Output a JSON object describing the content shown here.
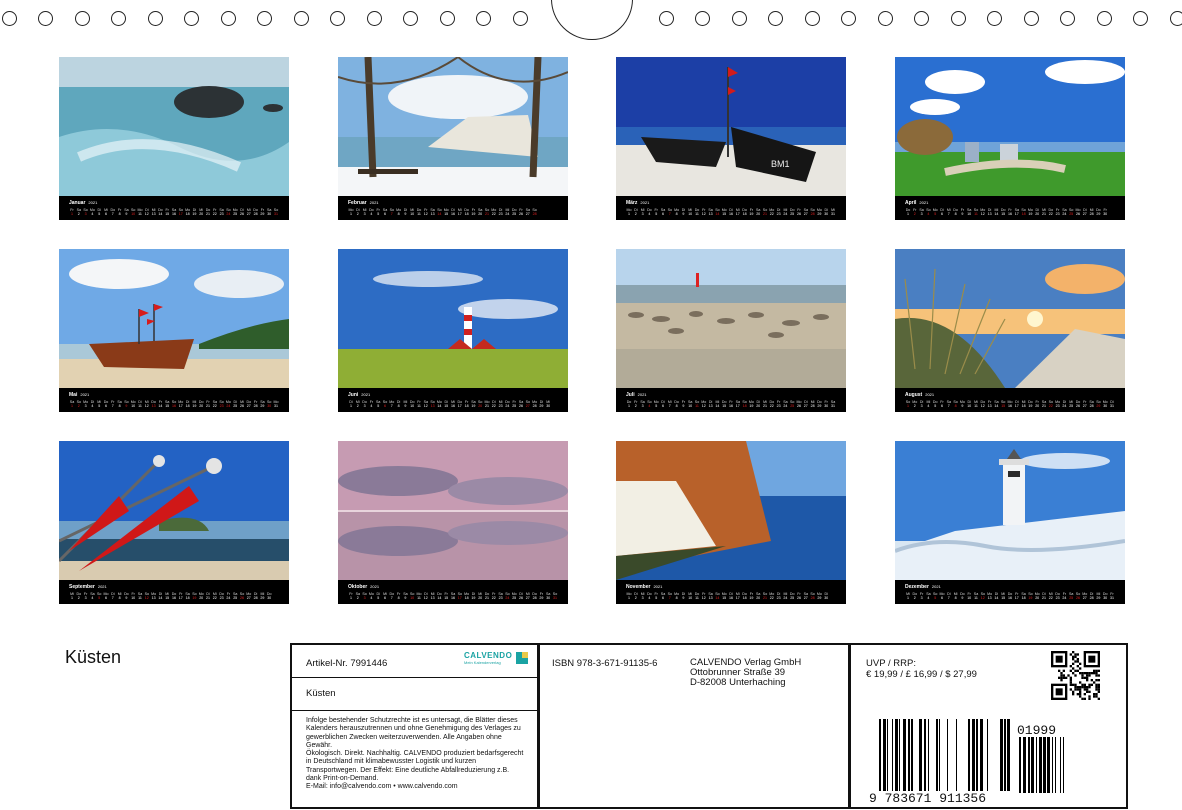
{
  "months": [
    {
      "name": "Januar",
      "year": "2021",
      "photo": "rock-in-sea",
      "first_weekday": 4,
      "length": 31,
      "holidays": [
        1
      ]
    },
    {
      "name": "Februar",
      "year": "2021",
      "photo": "chalk-cliffs-winter",
      "first_weekday": 0,
      "length": 28,
      "holidays": []
    },
    {
      "name": "März",
      "year": "2021",
      "photo": "fishing-boats-beach",
      "first_weekday": 0,
      "length": 31,
      "holidays": []
    },
    {
      "name": "April",
      "year": "2021",
      "photo": "beach-chairs-meadow",
      "first_weekday": 3,
      "length": 30,
      "holidays": [
        2,
        4,
        5
      ]
    },
    {
      "name": "Mai",
      "year": "2021",
      "photo": "red-boat-beach",
      "first_weekday": 5,
      "length": 31,
      "holidays": [
        1,
        13,
        23,
        24
      ]
    },
    {
      "name": "Juni",
      "year": "2021",
      "photo": "westerhever-lighthouse",
      "first_weekday": 1,
      "length": 30,
      "holidays": []
    },
    {
      "name": "Juli",
      "year": "2021",
      "photo": "seals-sandbank",
      "first_weekday": 3,
      "length": 31,
      "holidays": []
    },
    {
      "name": "August",
      "year": "2021",
      "photo": "dune-grass-sunset",
      "first_weekday": 6,
      "length": 31,
      "holidays": []
    },
    {
      "name": "September",
      "year": "2021",
      "photo": "red-fishing-flags",
      "first_weekday": 2,
      "length": 30,
      "holidays": []
    },
    {
      "name": "Oktober",
      "year": "2021",
      "photo": "pink-sky-reflection",
      "first_weekday": 4,
      "length": 31,
      "holidays": [
        3
      ]
    },
    {
      "name": "November",
      "year": "2021",
      "photo": "autumn-chalk-cliff",
      "first_weekday": 0,
      "length": 30,
      "holidays": []
    },
    {
      "name": "Dezember",
      "year": "2021",
      "photo": "frozen-lighthouse",
      "first_weekday": 2,
      "length": 31,
      "holidays": [
        25,
        26
      ]
    }
  ],
  "weekday_letters": [
    "Mo",
    "Di",
    "Mi",
    "Do",
    "Fr",
    "Sa",
    "So"
  ],
  "colors": {
    "sunday": "#e02020",
    "calendar_bar": "#000000",
    "calvendo_teal": "#1aa3a3"
  },
  "cover_title": "Küsten",
  "article": {
    "label": "Artikel-Nr. 7991446",
    "title": "Küsten"
  },
  "logo": {
    "name": "CALVENDO",
    "tagline": "Mein Kalenderverlag"
  },
  "legal": [
    "Infolge bestehender Schutzrechte ist es untersagt, die Blätter dieses",
    "Kalenders herauszutrennen und ohne Genehmigung des Verlages zu",
    "gewerblichen Zwecken weiterzuverwenden. Alle Angaben ohne",
    "Gewähr.",
    "Ökologisch. Direkt. Nachhaltig. CALVENDO produziert bedarfsgerecht",
    "in Deutschland mit klimabewusster Logistik und kurzen",
    "Transportwegen. Der Effekt: Eine deutliche Abfallreduzierung z.B.",
    "dank Print-on-Demand.",
    "E-Mail: info@calvendo.com • www.calvendo.com"
  ],
  "isbn": "ISBN 978-3-671-91135-6",
  "publisher": [
    "CALVENDO Verlag GmbH",
    "Ottobrunner Straße 39",
    "D-82008 Unterhaching"
  ],
  "price": {
    "label": "UVP / RRP:",
    "value": "€ 19,99 / £ 16,99 / $ 27,99"
  },
  "barcode": {
    "main": "9  783671  911356",
    "addon": "01999"
  }
}
